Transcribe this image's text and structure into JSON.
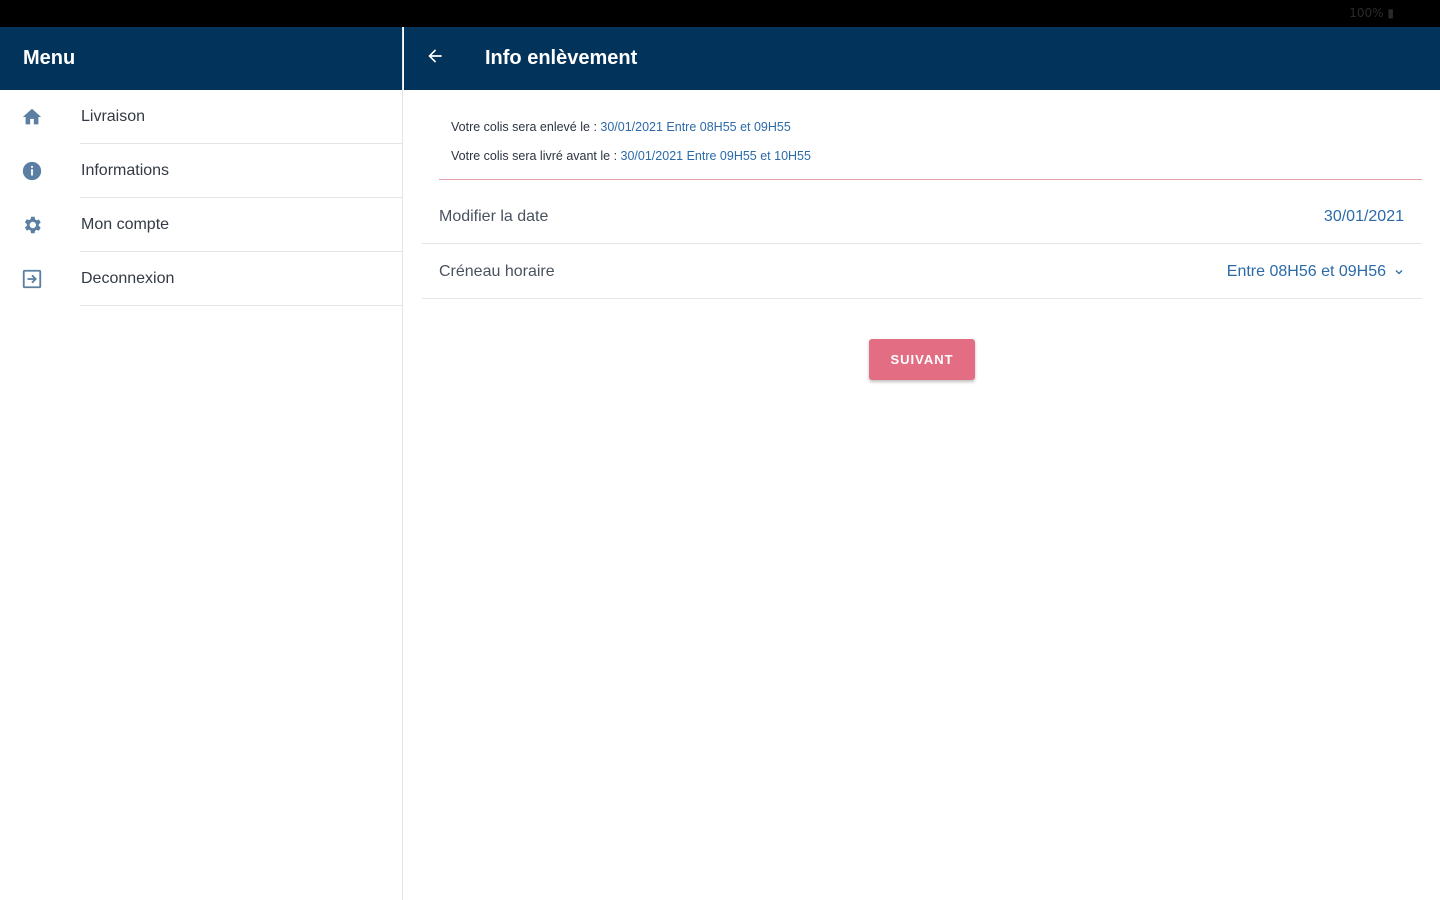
{
  "status_bar": {
    "battery": "100% ▮"
  },
  "sidebar": {
    "title": "Menu",
    "items": [
      {
        "label": "Livraison",
        "icon": "home-icon"
      },
      {
        "label": "Informations",
        "icon": "info-icon"
      },
      {
        "label": "Mon compte",
        "icon": "gear-icon"
      },
      {
        "label": "Deconnexion",
        "icon": "logout-icon"
      }
    ]
  },
  "header": {
    "title": "Info enlèvement",
    "back_icon": "arrow-left-icon"
  },
  "info": {
    "pickup_prefix": "Votre colis sera enlevé le : ",
    "pickup_value": "30/01/2021 Entre 08H55 et 09H55",
    "delivery_prefix": "Votre colis sera livré avant le : ",
    "delivery_value": "30/01/2021 Entre 09H55 et 10H55"
  },
  "form": {
    "date_label": "Modifier la date",
    "date_value": "30/01/2021",
    "slot_label": "Créneau horaire",
    "slot_value": "Entre 08H56 et 09H56"
  },
  "actions": {
    "next_label": "SUIVANT"
  },
  "colors": {
    "primary": "#02335b",
    "accent": "#e36d82",
    "link": "#2c6aa8",
    "icon": "#5b7fa3"
  }
}
